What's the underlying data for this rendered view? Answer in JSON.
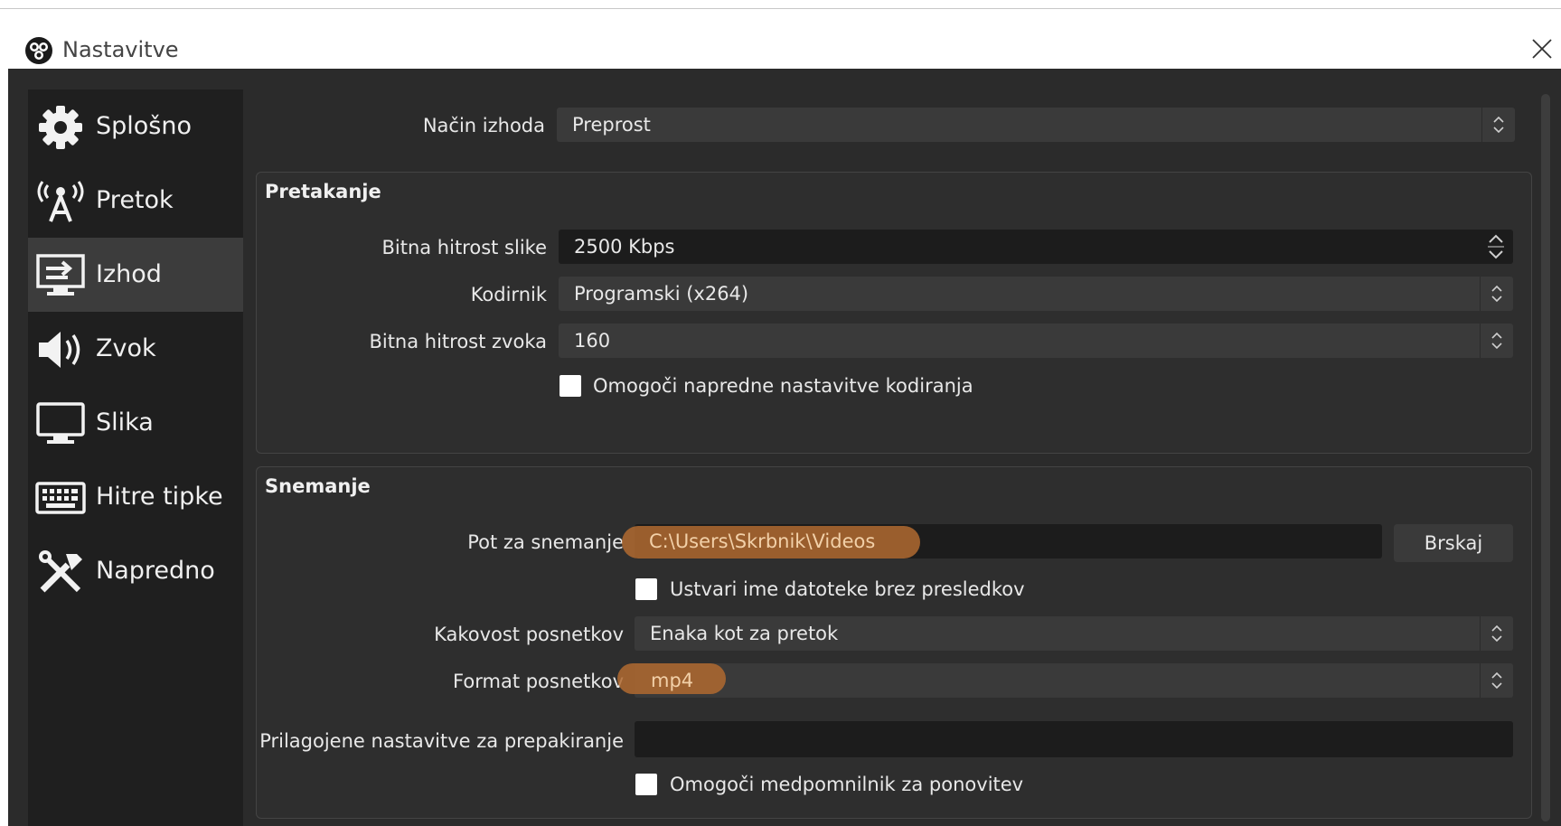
{
  "window": {
    "title": "Nastavitve"
  },
  "sidebar": {
    "items": [
      {
        "label": "Splošno",
        "icon": "gear-icon"
      },
      {
        "label": "Pretok",
        "icon": "broadcast-antenna-icon"
      },
      {
        "label": "Izhod",
        "icon": "output-monitor-icon",
        "active": true
      },
      {
        "label": "Zvok",
        "icon": "speaker-icon"
      },
      {
        "label": "Slika",
        "icon": "monitor-icon"
      },
      {
        "label": "Hitre tipke",
        "icon": "keyboard-icon"
      },
      {
        "label": "Napredno",
        "icon": "tools-icon"
      }
    ]
  },
  "output_mode": {
    "label": "Način izhoda",
    "value": "Preprost"
  },
  "streaming": {
    "title": "Pretakanje",
    "video_bitrate": {
      "label": "Bitna hitrost slike",
      "value": "2500 Kbps"
    },
    "encoder": {
      "label": "Kodirnik",
      "value": "Programski (x264)"
    },
    "audio_bitrate": {
      "label": "Bitna hitrost zvoka",
      "value": "160"
    },
    "advanced_encoder": {
      "label": "Omogoči napredne nastavitve kodiranja",
      "checked": false
    }
  },
  "recording": {
    "title": "Snemanje",
    "path": {
      "label": "Pot za snemanje",
      "value": "C:\\Users\\Skrbnik\\Videos",
      "browse_label": "Brskaj"
    },
    "no_spaces": {
      "label": "Ustvari ime datoteke brez presledkov",
      "checked": false
    },
    "quality": {
      "label": "Kakovost posnetkov",
      "value": "Enaka kot za pretok"
    },
    "format": {
      "label": "Format posnetkov",
      "value": "mp4"
    },
    "muxer": {
      "label": "Prilagojene nastavitve za prepakiranje",
      "value": ""
    },
    "replay_buffer": {
      "label": "Omogoči medpomnilnik za ponovitev",
      "checked": false
    }
  },
  "colors": {
    "highlight": "#b06a30",
    "background": "#2b2b2b",
    "sidebar": "#1f1f1f"
  }
}
